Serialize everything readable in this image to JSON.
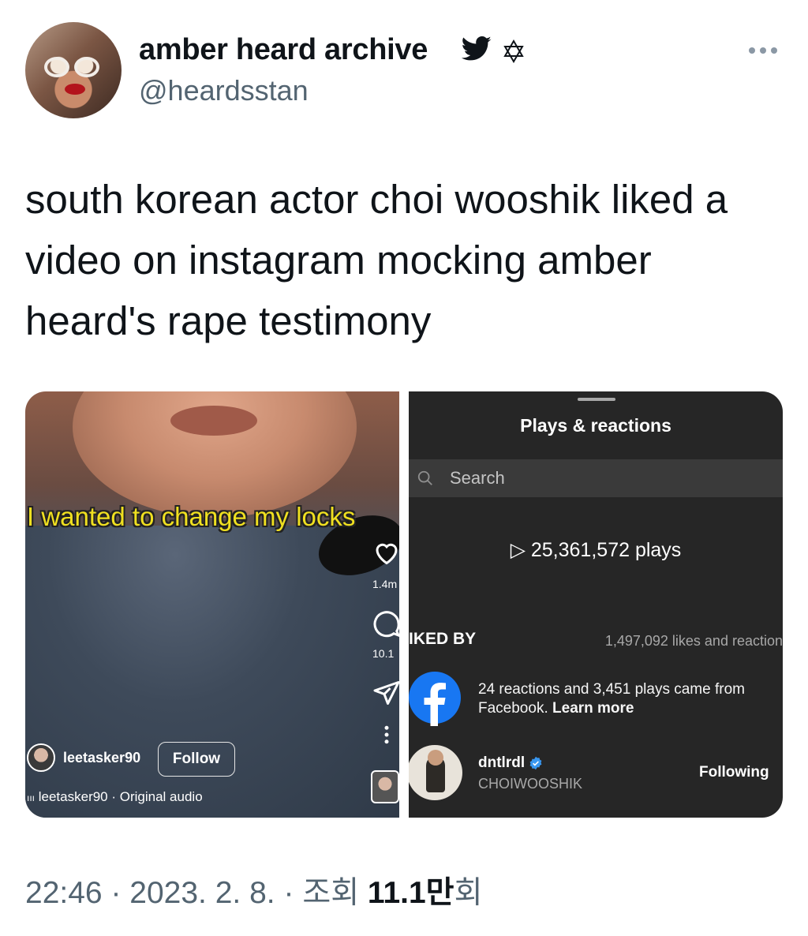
{
  "author": {
    "display_name": "amber heard archive",
    "handle": "@heardsstan",
    "icons": [
      "twitter-bird-icon",
      "star-of-david-icon",
      "more-options-icon"
    ]
  },
  "tweet": {
    "text": "south korean actor choi wooshik liked a video on instagram mocking amber heard's rape testimony"
  },
  "media": {
    "left_panel": {
      "caption": "I wanted to change my locks",
      "like_count": "1.4m",
      "comment_count": "10.1",
      "username": "leetasker90",
      "follow_label": "Follow",
      "audio_label": "leetasker90 · Original audio"
    },
    "right_panel": {
      "title": "Plays & reactions",
      "search_placeholder": "Search",
      "plays": "25,361,572 plays",
      "liked_by_label": "IKED BY",
      "likes_count": "1,497,092 likes and reaction",
      "facebook_note": "24 reactions and 3,451 plays came from Facebook.",
      "learn_more": "Learn more",
      "user": {
        "username": "dntlrdl",
        "full_name": "CHOIWOOSHIK",
        "following_label": "Following",
        "verified": true
      }
    }
  },
  "meta": {
    "time": "22:46",
    "date": "2023. 2. 8.",
    "views_prefix": "조회",
    "views_value": "11.1만",
    "views_suffix": "회",
    "separator": "·"
  },
  "colors": {
    "text_primary": "#0f1419",
    "text_secondary": "#536471",
    "twitter_blue": "#1d9bf0",
    "facebook_blue": "#1877f2",
    "sheet_bg": "#262626",
    "caption_yellow": "#f0e020"
  }
}
